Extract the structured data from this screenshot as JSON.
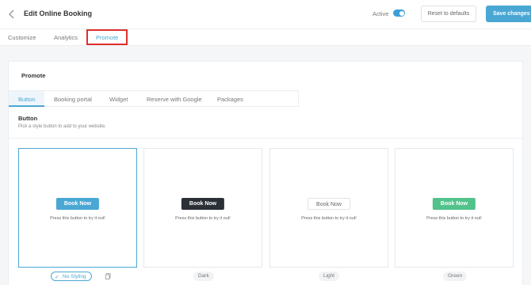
{
  "header": {
    "title": "Edit Online Booking",
    "active_label": "Active",
    "active_on": true,
    "reset_label": "Reset to defaults",
    "save_label": "Save changes"
  },
  "main_tabs": [
    {
      "label": "Customize",
      "active": false
    },
    {
      "label": "Analytics",
      "active": false
    },
    {
      "label": "Promote",
      "active": true
    }
  ],
  "promote": {
    "title": "Promote",
    "sub_tabs": [
      {
        "label": "Button",
        "active": true
      },
      {
        "label": "Booking portal",
        "active": false
      },
      {
        "label": "Widget",
        "active": false
      },
      {
        "label": "Reserve with Google",
        "active": false
      },
      {
        "label": "Packages",
        "active": false
      }
    ],
    "section_title": "Button",
    "section_desc": "Pick a style button to add to your website.",
    "options": [
      {
        "button_label": "Book Now",
        "hint": "Press this button to try it out!",
        "name": "No Styling",
        "selected": true
      },
      {
        "button_label": "Book Now",
        "hint": "Press this button to try it out!",
        "name": "Dark",
        "selected": false
      },
      {
        "button_label": "Book Now",
        "hint": "Press this button to try it out!",
        "name": "Light",
        "selected": false
      },
      {
        "button_label": "Book Now",
        "hint": "Press this button to try it out!",
        "name": "Green",
        "selected": false
      }
    ]
  },
  "colors": {
    "accent": "#4aa7d4",
    "dark_button": "#2b2f36",
    "green_button": "#52c28b",
    "highlight": "#e0302b"
  }
}
